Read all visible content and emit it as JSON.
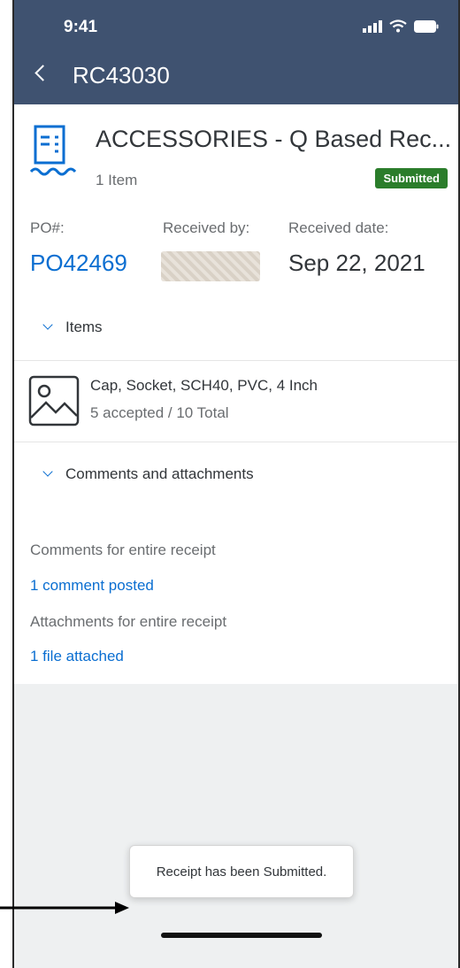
{
  "status_bar": {
    "time": "9:41"
  },
  "nav": {
    "title": "RC43030"
  },
  "receipt": {
    "title": "ACCESSORIES - Q Based Rec...",
    "items_count": "1 Item",
    "status_badge": "Submitted",
    "po_label": "PO#:",
    "po_value": "PO42469",
    "received_by_label": "Received by:",
    "received_date_label": "Received date:",
    "received_date": "Sep 22, 2021"
  },
  "items_section": {
    "header": "Items",
    "items": [
      {
        "name": "Cap, Socket, SCH40, PVC, 4 Inch",
        "status": "5 accepted / 10 Total"
      }
    ]
  },
  "comments_section": {
    "header": "Comments and attachments",
    "comments_label": "Comments for entire receipt",
    "comments_link": "1 comment posted",
    "attachments_label": "Attachments for entire receipt",
    "attachments_link": "1 file attached"
  },
  "toast": {
    "message": "Receipt has been Submitted."
  },
  "colors": {
    "header_bg": "#3f5270",
    "link": "#0a6ed1",
    "badge_bg": "#2b7d2b"
  }
}
